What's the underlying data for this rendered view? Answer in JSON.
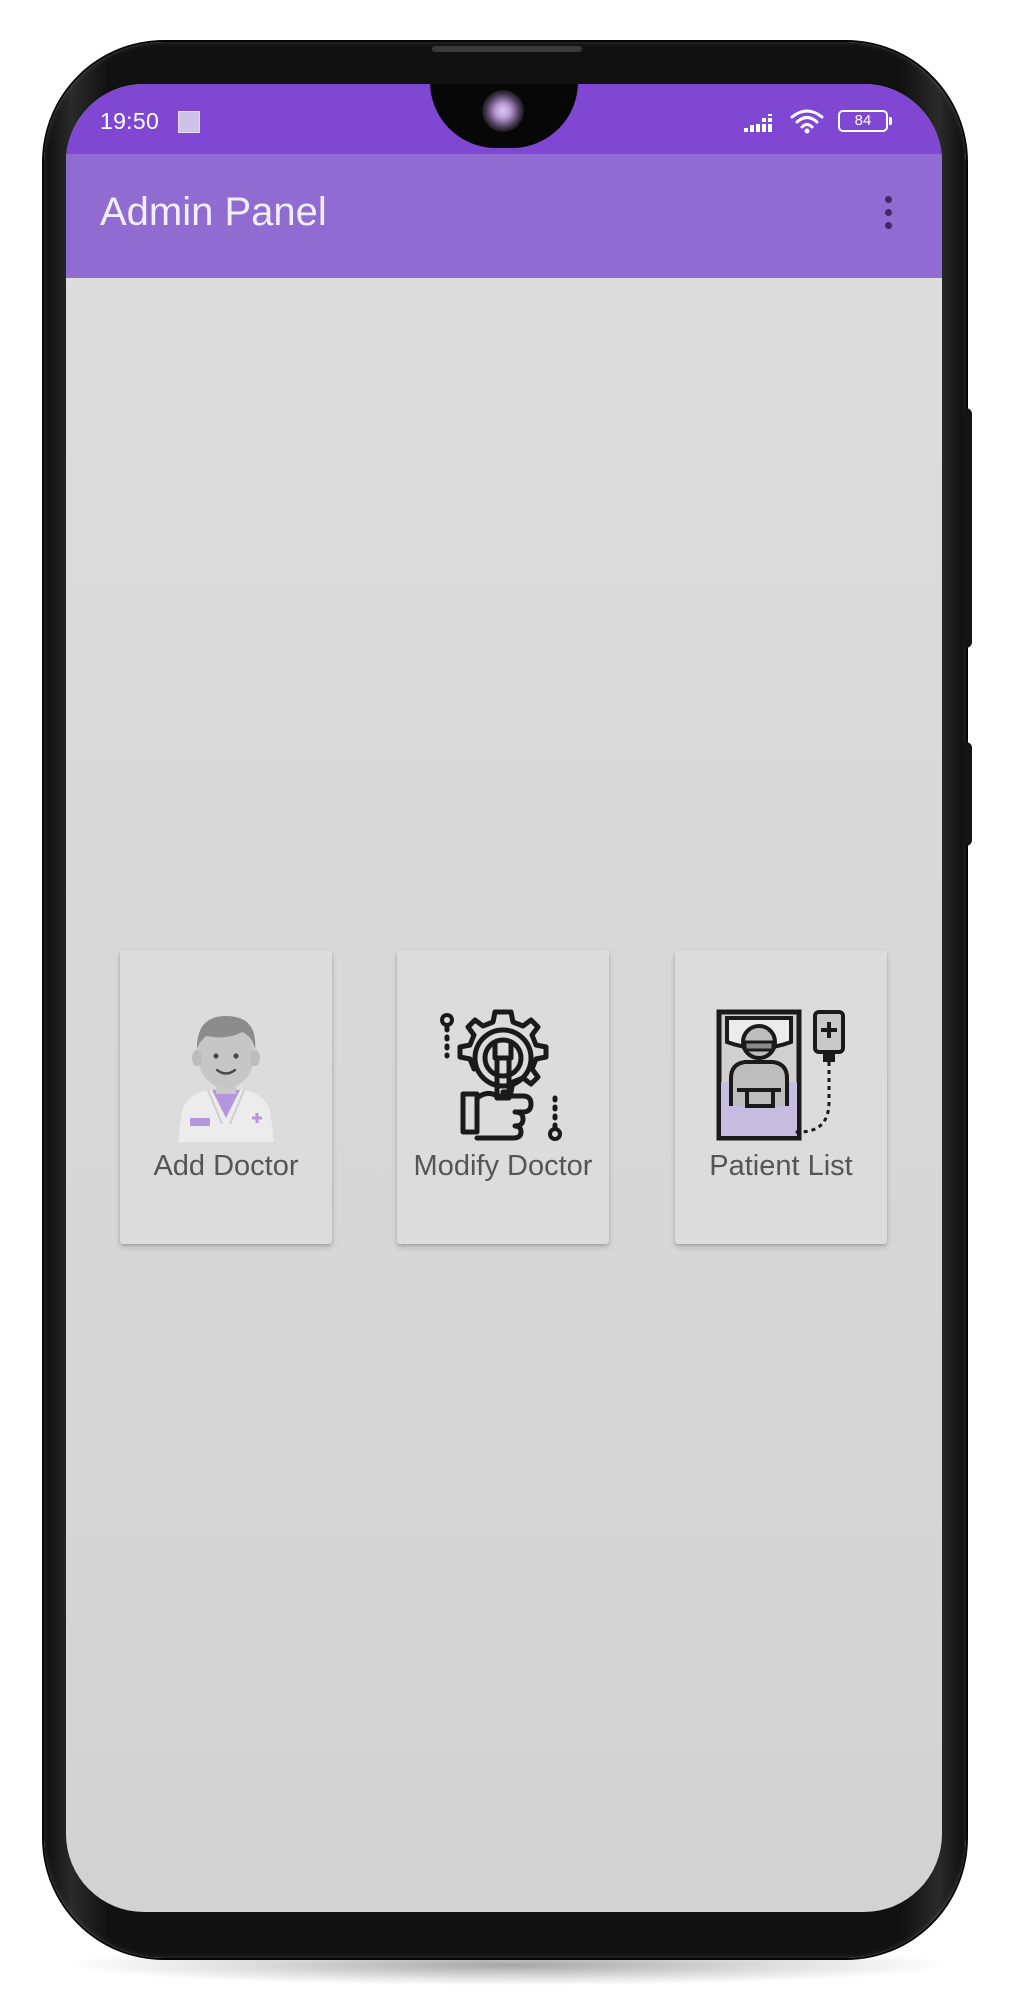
{
  "status_bar": {
    "time": "19:50",
    "battery_level": "84",
    "icons": [
      "notification-square-icon",
      "signal-icon",
      "wifi-icon",
      "battery-icon"
    ]
  },
  "app_bar": {
    "title": "Admin Panel",
    "overflow_icon": "more-vert-icon"
  },
  "menu": {
    "items": [
      {
        "label": "Add Doctor",
        "icon": "doctor-icon"
      },
      {
        "label": "Modify Doctor",
        "icon": "wrench-gear-icon"
      },
      {
        "label": "Patient List",
        "icon": "patient-bed-icon"
      }
    ]
  },
  "colors": {
    "status_bar": "#8048d2",
    "app_bar": "#8f6bd2",
    "background": "#d9d9d9",
    "card": "#dcdcdc",
    "label_text": "#555555"
  }
}
